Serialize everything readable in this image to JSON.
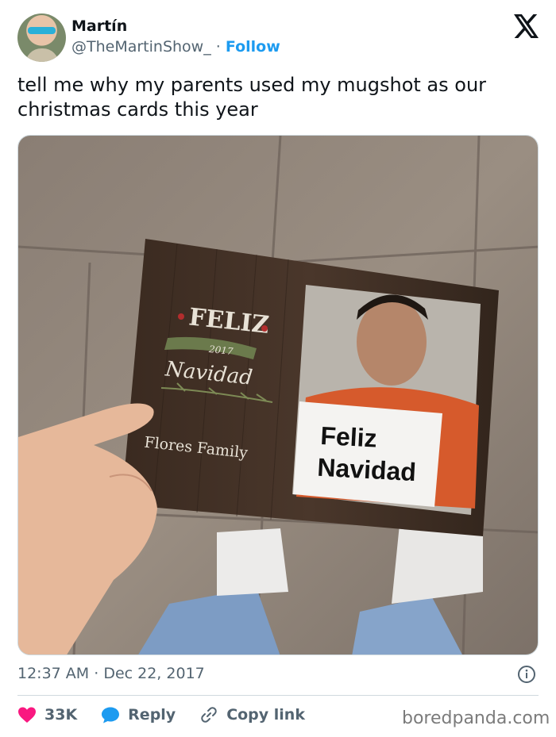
{
  "author": {
    "display_name": "Martín",
    "handle": "@TheMartinShow_",
    "separator": "·",
    "follow_label": "Follow"
  },
  "platform_icon": "x-logo-icon",
  "tweet": {
    "text": "tell me why my parents used my mugshot as our christmas cards this year"
  },
  "photo": {
    "card": {
      "feliz": "FELIZ",
      "year": "2017",
      "navidad_script": "Navidad",
      "family": "Flores Family",
      "sign_line1": "Feliz",
      "sign_line2": "Navidad"
    }
  },
  "meta": {
    "time": "12:37 AM",
    "separator": "·",
    "date": "Dec 22, 2017",
    "info_icon": "info-icon"
  },
  "actions": {
    "likes": "33K",
    "reply_label": "Reply",
    "copy_link_label": "Copy link"
  },
  "watermark": "boredpanda.com",
  "colors": {
    "like": "#f91880",
    "reply": "#1d9bf0",
    "link": "#1d9bf0",
    "muted": "#536471"
  }
}
